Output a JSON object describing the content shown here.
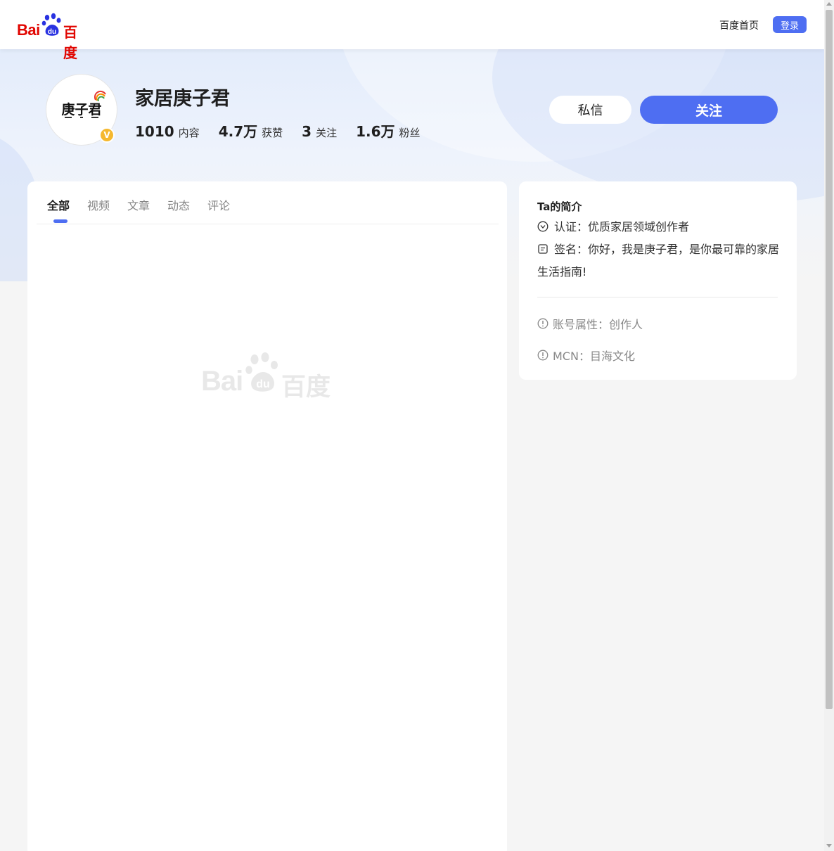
{
  "nav": {
    "logo_latin": "Bai",
    "logo_du": "du",
    "logo_cn": "百度",
    "home_link": "百度首页",
    "login_button": "登录"
  },
  "profile": {
    "avatar_text": "庚子君",
    "verified_badge": "V",
    "name": "家居庚子君",
    "stats": [
      {
        "value": "1010",
        "label": "内容"
      },
      {
        "value": "4.7万",
        "label": "获赞"
      },
      {
        "value": "3",
        "label": "关注"
      },
      {
        "value": "1.6万",
        "label": "粉丝"
      }
    ],
    "message_button": "私信",
    "follow_button": "关注"
  },
  "tabs": [
    {
      "label": "全部",
      "active": true
    },
    {
      "label": "视频",
      "active": false
    },
    {
      "label": "文章",
      "active": false
    },
    {
      "label": "动态",
      "active": false
    },
    {
      "label": "评论",
      "active": false
    }
  ],
  "placeholder": {
    "logo_latin": "Bai",
    "logo_du": "du",
    "logo_cn": "百度"
  },
  "intro": {
    "title": "Ta的简介",
    "certification": "认证：优质家居领域创作者",
    "signature": "签名：你好，我是庚子君，是你最可靠的家居生活指南!",
    "account_type": "账号属性：创作人",
    "mcn": "MCN：目海文化"
  },
  "colors": {
    "brand_red": "#e10601",
    "accent_blue": "#4e6ef2",
    "badge_gold": "#f5b82e"
  }
}
